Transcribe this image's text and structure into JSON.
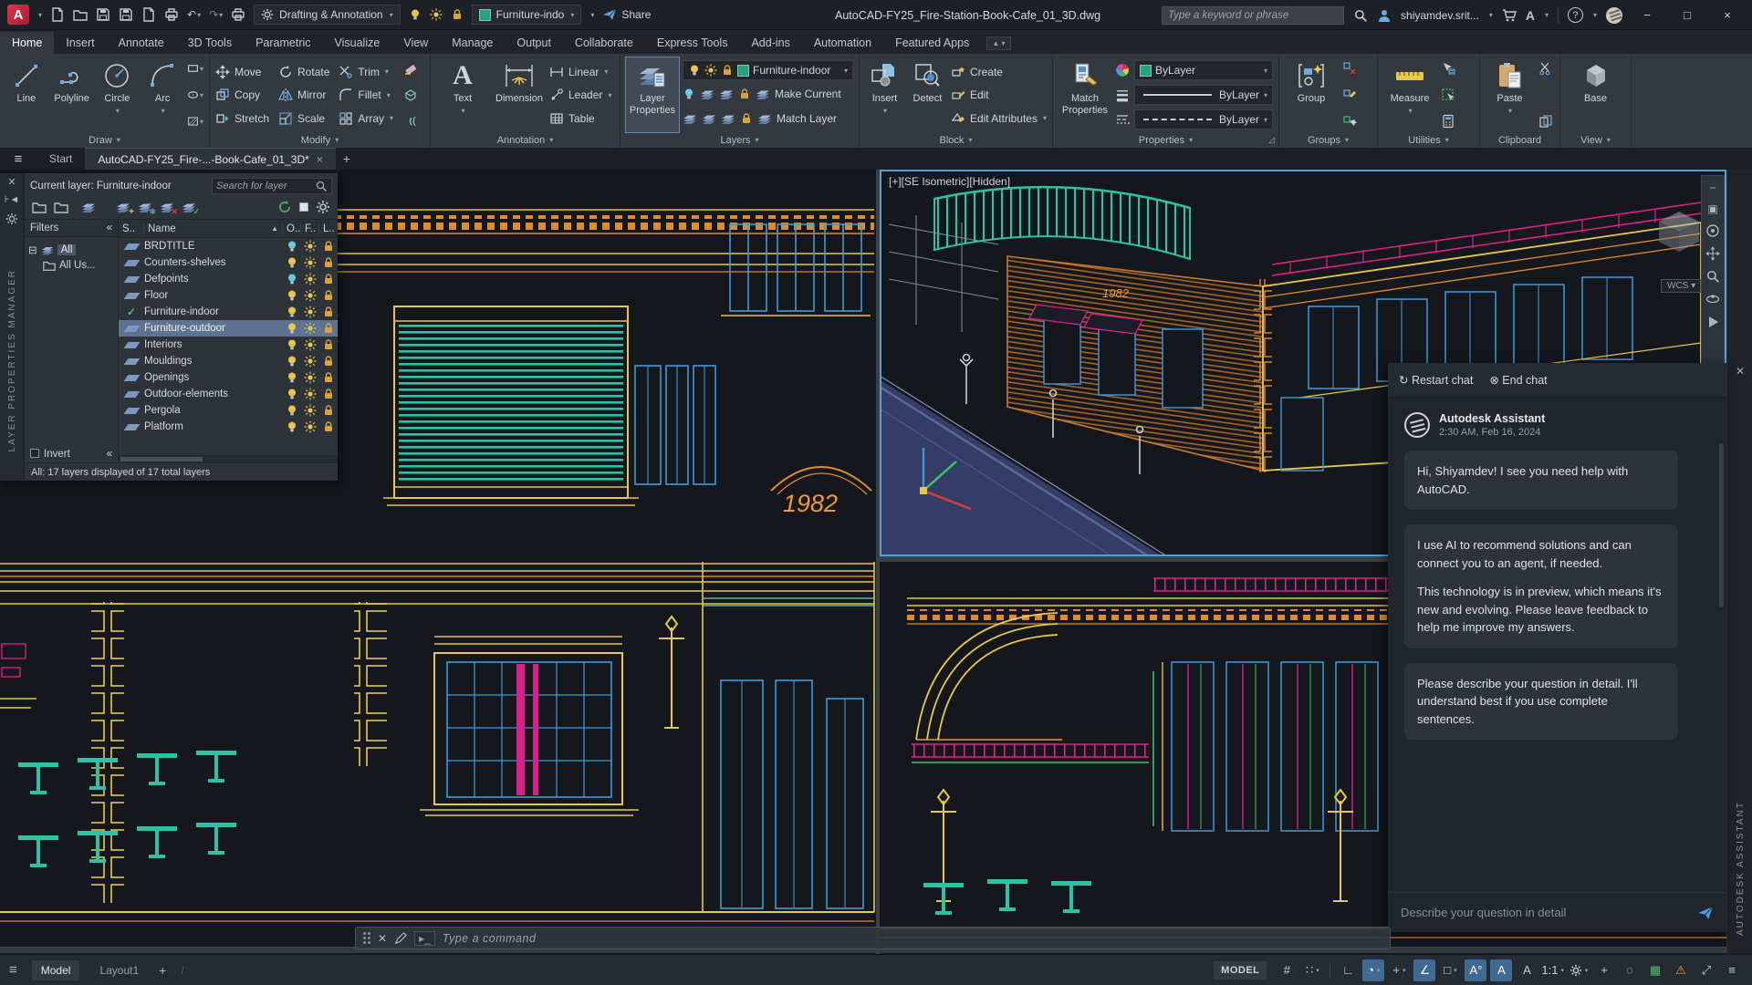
{
  "titlebar": {
    "app_logo": "A",
    "workspace": "Drafting & Annotation",
    "qat_layer": "Furniture-indo",
    "share_label": "Share",
    "document_title": "AutoCAD-FY25_Fire-Station-Book-Cafe_01_3D.dwg",
    "search_placeholder": "Type a keyword or phrase",
    "user": "shiyamdev.srit..."
  },
  "ribbon": {
    "active_tab": "Home",
    "tabs": [
      "Home",
      "Insert",
      "Annotate",
      "3D Tools",
      "Parametric",
      "Visualize",
      "View",
      "Manage",
      "Output",
      "Collaborate",
      "Express Tools",
      "Add-ins",
      "Automation",
      "Featured Apps"
    ],
    "panels": {
      "draw": {
        "label": "Draw",
        "line": "Line",
        "polyline": "Polyline",
        "circle": "Circle",
        "arc": "Arc"
      },
      "modify": {
        "label": "Modify",
        "move": "Move",
        "copy": "Copy",
        "stretch": "Stretch",
        "rotate": "Rotate",
        "mirror": "Mirror",
        "scale": "Scale",
        "trim": "Trim",
        "fillet": "Fillet",
        "array": "Array"
      },
      "annotation": {
        "label": "Annotation",
        "text": "Text",
        "dimension": "Dimension",
        "linear": "Linear",
        "leader": "Leader",
        "table": "Table"
      },
      "layers": {
        "label": "Layers",
        "layer_properties": "Layer Properties",
        "current_layer": "Furniture-indoor",
        "make_current": "Make Current",
        "match_layer": "Match Layer"
      },
      "block": {
        "label": "Block",
        "insert": "Insert",
        "detect": "Detect",
        "create": "Create",
        "edit": "Edit",
        "edit_attributes": "Edit Attributes"
      },
      "properties": {
        "label": "Properties",
        "match_properties": "Match Properties",
        "color": "ByLayer",
        "lineweight": "ByLayer",
        "linetype": "ByLayer"
      },
      "groups": {
        "label": "Groups",
        "group": "Group"
      },
      "utilities": {
        "label": "Utilities",
        "measure": "Measure"
      },
      "clipboard": {
        "label": "Clipboard",
        "paste": "Paste"
      },
      "view": {
        "label": "View",
        "base": "Base"
      }
    }
  },
  "filetabs": {
    "start": "Start",
    "document": "AutoCAD-FY25_Fire-...-Book-Cafe_01_3D*"
  },
  "layer_manager": {
    "panel_title": "LAYER PROPERTIES MANAGER",
    "current_layer_label": "Current layer: Furniture-indoor",
    "search_placeholder": "Search for layer",
    "filters_label": "Filters",
    "tree": {
      "all": "All",
      "all_used": "All Us..."
    },
    "columns": {
      "status": "S..",
      "name": "Name",
      "on": "O..",
      "freeze": "F..",
      "lock": "L.."
    },
    "rows": [
      {
        "name": "BRDTITLE",
        "on": false,
        "current": false,
        "selected": false
      },
      {
        "name": "Counters-shelves",
        "on": true,
        "current": false,
        "selected": false
      },
      {
        "name": "Defpoints",
        "on": false,
        "current": false,
        "selected": false
      },
      {
        "name": "Floor",
        "on": true,
        "current": false,
        "selected": false
      },
      {
        "name": "Furniture-indoor",
        "on": true,
        "current": true,
        "selected": false
      },
      {
        "name": "Furniture-outdoor",
        "on": true,
        "current": false,
        "selected": true
      },
      {
        "name": "Interiors",
        "on": true,
        "current": false,
        "selected": false
      },
      {
        "name": "Mouldings",
        "on": true,
        "current": false,
        "selected": false
      },
      {
        "name": "Openings",
        "on": true,
        "current": false,
        "selected": false
      },
      {
        "name": "Outdoor-elements",
        "on": true,
        "current": false,
        "selected": false
      },
      {
        "name": "Pergola",
        "on": true,
        "current": false,
        "selected": false
      },
      {
        "name": "Platform",
        "on": true,
        "current": false,
        "selected": false
      }
    ],
    "invert_label": "Invert",
    "status_text": "All: 17 layers displayed of 17 total layers"
  },
  "viewport": {
    "top_right_label": "[+][SE Isometric][Hidden]",
    "wcs": "WCS",
    "year_sign": "1982"
  },
  "assistant": {
    "side_title": "AUTODESK ASSISTANT",
    "restart": "Restart chat",
    "end": "End chat",
    "name": "Autodesk Assistant",
    "time": "2:30 AM, Feb 16, 2024",
    "msg1": "Hi, Shiyamdev! I see you need help with AutoCAD.",
    "msg2a": "I use AI to recommend solutions and can connect you to an agent, if needed.",
    "msg2b": "This technology is in preview, which means it's new and evolving. Please leave feedback to help me improve my answers.",
    "msg3": "Please describe your question in detail. I'll understand best if you use complete sentences.",
    "input_placeholder": "Describe your question in detail"
  },
  "commandline": {
    "placeholder": "Type a command"
  },
  "statusbar": {
    "model_tab": "Model",
    "layout_tab": "Layout1",
    "model_badge": "MODEL",
    "scale": "1:1"
  },
  "colors": {
    "accent_blue": "#4a9edd",
    "selection_blue": "#5e7391",
    "teal": "#2fc1a3",
    "yellow": "#e6c84a",
    "orange": "#ef9b32",
    "magenta": "#e0218a",
    "blue": "#3f9bdc",
    "green": "#3ec06a",
    "bulb_on": "#e8c64b",
    "bulb_off": "#62cfe0",
    "swatch_green": "#1fa67a",
    "street": "#333d66",
    "logo_red": "#c2283c"
  }
}
